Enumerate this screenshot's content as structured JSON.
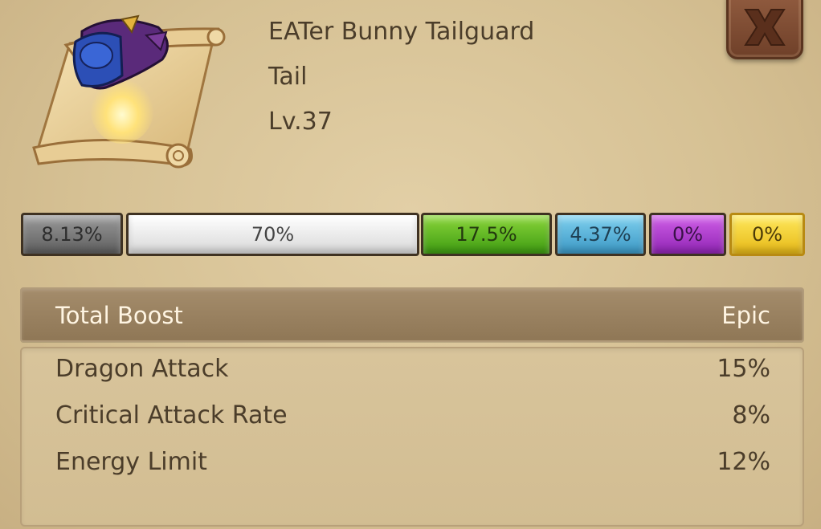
{
  "item": {
    "name": "EATer Bunny Tailguard",
    "slot": "Tail",
    "level": "Lv.37"
  },
  "icons": {
    "item": "scroll-armor-icon",
    "close": "close-x-icon"
  },
  "rarity_bars": [
    {
      "label": "8.13%",
      "color": "#7a7a7a"
    },
    {
      "label": "70%",
      "color": "#f0f0f0"
    },
    {
      "label": "17.5%",
      "color": "#5cb824"
    },
    {
      "label": "4.37%",
      "color": "#55b2de"
    },
    {
      "label": "0%",
      "color": "#b03fd0"
    },
    {
      "label": "0%",
      "color": "#f5d430"
    }
  ],
  "boost": {
    "label": "Total Boost",
    "rarity": "Epic"
  },
  "stats": [
    {
      "name": "Dragon Attack",
      "value": "15%"
    },
    {
      "name": "Critical Attack Rate",
      "value": "8%"
    },
    {
      "name": "Energy Limit",
      "value": "12%"
    }
  ]
}
